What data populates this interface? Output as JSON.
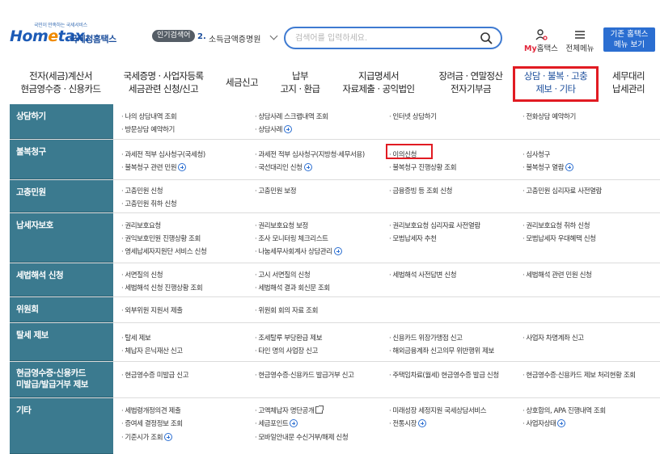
{
  "header": {
    "logo": {
      "tagline": "국민이 만족하는 국세서비스",
      "wordmark_a": "Hom",
      "wordmark_e": "e",
      "wordmark_b": "tax.",
      "site_name": "국세청홈택스"
    },
    "popular": {
      "badge": "인기검색어",
      "rank": "2.",
      "keyword": "소득금액증명원"
    },
    "search": {
      "placeholder": "검색어를 입력하세요."
    },
    "my_hometax": {
      "prefix": "My",
      "rest": "홈택스"
    },
    "all_menu": "전체메뉴",
    "old_menu": {
      "line1": "기존 홈택스",
      "line2": "메뉴 보기"
    }
  },
  "gnb": [
    {
      "line1": "전자(세금)계산서",
      "line2": "현금영수증 · 신용카드"
    },
    {
      "line1": "국세증명 · 사업자등록",
      "line2": "세금관련 신청/신고"
    },
    {
      "line1": "세금신고",
      "line2": ""
    },
    {
      "line1": "납부",
      "line2": "고지 · 환급"
    },
    {
      "line1": "지급명세서",
      "line2": "자료제출 · 공익법인"
    },
    {
      "line1": "장려금 · 연말정산",
      "line2": "전자기부금"
    },
    {
      "line1": "상담 · 불복 · 고충",
      "line2": "제보 · 기타"
    },
    {
      "line1": "세무대리",
      "line2": "납세관리"
    }
  ],
  "menu": {
    "consult": {
      "title": "상담하기",
      "c1": [
        "나의 상담내역 조회",
        "방문상담 예약하기"
      ],
      "c2": [
        "상담사례 스크랩내역 조회",
        "상담사례"
      ],
      "c3": [
        "인터넷 상담하기"
      ],
      "c4": [
        "전화상담 예약하기"
      ]
    },
    "appeal": {
      "title": "불복청구",
      "c1": [
        "과세전 적부 심사청구(국세청)",
        "불복청구 관련 민원"
      ],
      "c2": [
        "과세전 적부 심사청구(지방청·세무서용)",
        "국선대리인 신청"
      ],
      "c3": [
        "이의신청",
        "불복청구 진행상황 조회"
      ],
      "c4": [
        "심사청구",
        "불복청구 열람"
      ]
    },
    "grievance": {
      "title": "고충민원",
      "c1": [
        "고충민원 신청",
        "고충민원 취하 신청"
      ],
      "c2": [
        "고충민원 보정"
      ],
      "c3": [
        "금융증빙 등 조회 신청"
      ],
      "c4": [
        "고충민원 심리자료 사전열람"
      ]
    },
    "protection": {
      "title": "납세자보호",
      "c1": [
        "권리보호요청",
        "권익보호민원 진행상황 조회",
        "영세납세자지원단 서비스 신청"
      ],
      "c2": [
        "권리보호요청 보정",
        "조사 모니터링 체크리스트",
        "나눔세무사회계사 상담관리"
      ],
      "c3": [
        "권리보호요청 심리자료 사전열람",
        "모범납세자 추천"
      ],
      "c4": [
        "권리보호요청 취하 신청",
        "모범납세자 우대혜택 신청"
      ]
    },
    "interpret": {
      "title": "세법해석 신청",
      "c1": [
        "서면질의 신청",
        "세법해석 신청 진행상황 조회"
      ],
      "c2": [
        "고시 서면질의 신청",
        "세법해석 결과 회신문 조회"
      ],
      "c3": [
        "세법해석 사전답변 신청"
      ],
      "c4": [
        "세법해석 관련 민원 신청"
      ]
    },
    "committee": {
      "title": "위원회",
      "c1": [
        "외부위원 지원서 제출"
      ],
      "c2": [
        "위원회 회의 자료 조회"
      ],
      "c3": [],
      "c4": []
    },
    "report": {
      "title": "탈세 제보",
      "c1": [
        "탈세 제보",
        "체납자 은닉재산 신고"
      ],
      "c2": [
        "조세탈루 부당환급 제보",
        "타인 명의 사업장 신고"
      ],
      "c3": [
        "신용카드 위장가맹점 신고",
        "해외금융계좌 신고의무 위반행위 제보"
      ],
      "c4": [
        "사업자 차명계좌 신고"
      ]
    },
    "cashreceipt": {
      "title1": "현금영수증·신용카드",
      "title2": "미발급/발급거부 제보",
      "c1": [
        "현금영수증 미발급 신고"
      ],
      "c2": [
        "현금영수증·신용카드 발급거부 신고"
      ],
      "c3": [
        "주택임차료(월세) 현금영수증 발급 신청"
      ],
      "c4": [
        "현금영수증·신용카드 제보 처리현황 조회"
      ]
    },
    "etc": {
      "title": "기타",
      "c1": [
        "세법령개정의견 제출",
        "증여세 결정정보 조회",
        "기준시가 조회"
      ],
      "c2": [
        "고액체납자 명단공개",
        "세금포인트",
        "모바일안내문 수신거부/해제 신청"
      ],
      "c3": [
        "미래성장 세정지원 국세상담서비스",
        "전통시장"
      ],
      "c4": [
        "상호합의, APA 진행내역 조회",
        "사업자상태"
      ]
    }
  }
}
